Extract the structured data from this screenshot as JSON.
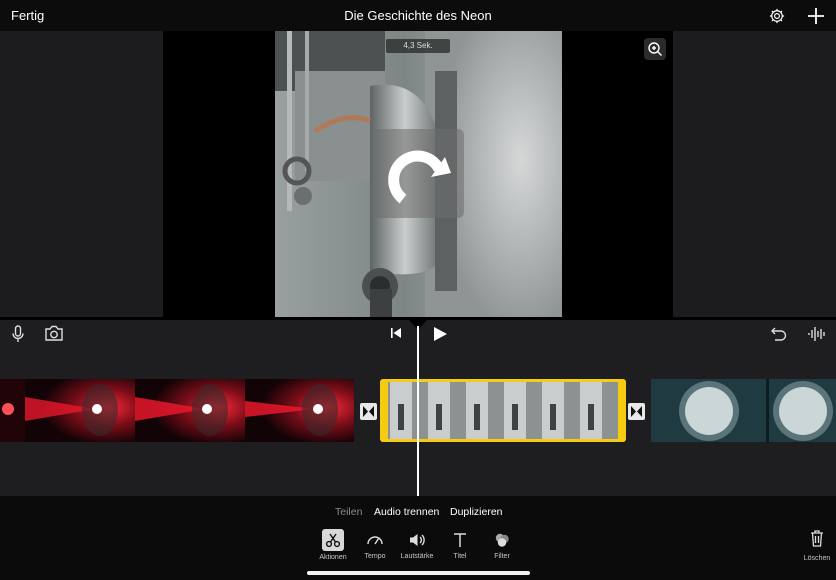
{
  "header": {
    "done_label": "Fertig",
    "title": "Die Geschichte des Neon",
    "settings_icon": "gear-icon",
    "add_icon": "plus-icon"
  },
  "viewer": {
    "duration_badge": "4,3 Sek.",
    "rotate_icon": "rotate-clockwise-icon",
    "zoom_icon": "zoom-in-icon"
  },
  "timeline_toolbar": {
    "left_icons": [
      "microphone-icon",
      "camera-icon"
    ],
    "center_icons": [
      "skip-to-start-icon",
      "play-icon"
    ],
    "right_icons": [
      "undo-icon",
      "audio-waveform-icon"
    ]
  },
  "actions": {
    "split_label": "Teilen",
    "detach_audio_label": "Audio trennen",
    "duplicate_label": "Duplizieren"
  },
  "tools": [
    {
      "label": "Aktionen",
      "icon": "scissors-icon",
      "selected": true
    },
    {
      "label": "Tempo",
      "icon": "speedometer-icon",
      "selected": false
    },
    {
      "label": "Lautstärke",
      "icon": "speaker-icon",
      "selected": false
    },
    {
      "label": "Titel",
      "icon": "text-icon",
      "selected": false
    },
    {
      "label": "Filter",
      "icon": "filter-circles-icon",
      "selected": false
    }
  ],
  "delete_label": "Löschen",
  "colors": {
    "selection": "#f5cc12",
    "panel": "#1c1c1e",
    "timeline_bg": "#1e1e20"
  }
}
